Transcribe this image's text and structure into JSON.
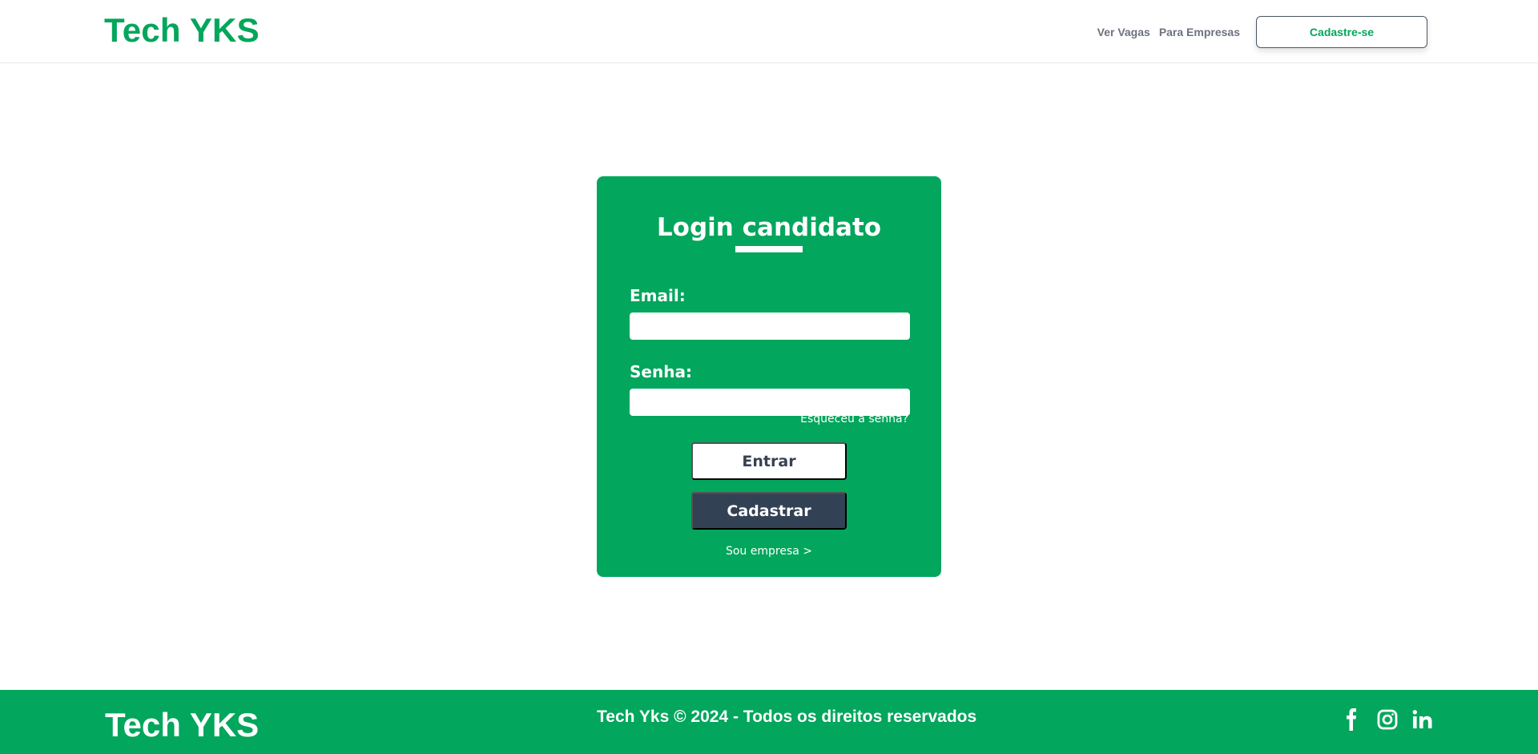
{
  "header": {
    "brand": "Tech YKS",
    "nav": {
      "jobs": "Ver Vagas",
      "companies": "Para Empresas",
      "signup": "Cadastre-se"
    }
  },
  "login": {
    "title": "Login candidato",
    "email_label": "Email:",
    "email_value": "",
    "password_label": "Senha:",
    "password_value": "",
    "forgot": "Esqueceu a senha?",
    "enter": "Entrar",
    "register": "Cadastrar",
    "company": "Sou empresa >"
  },
  "footer": {
    "brand": "Tech YKS",
    "copyright": "Tech Yks © 2024 - Todos os direitos reservados",
    "social": [
      "facebook-icon",
      "instagram-icon",
      "linkedin-icon"
    ]
  },
  "colors": {
    "brand_green": "#02a65c",
    "dark_button": "#334155",
    "nav_text": "#6b7280"
  }
}
